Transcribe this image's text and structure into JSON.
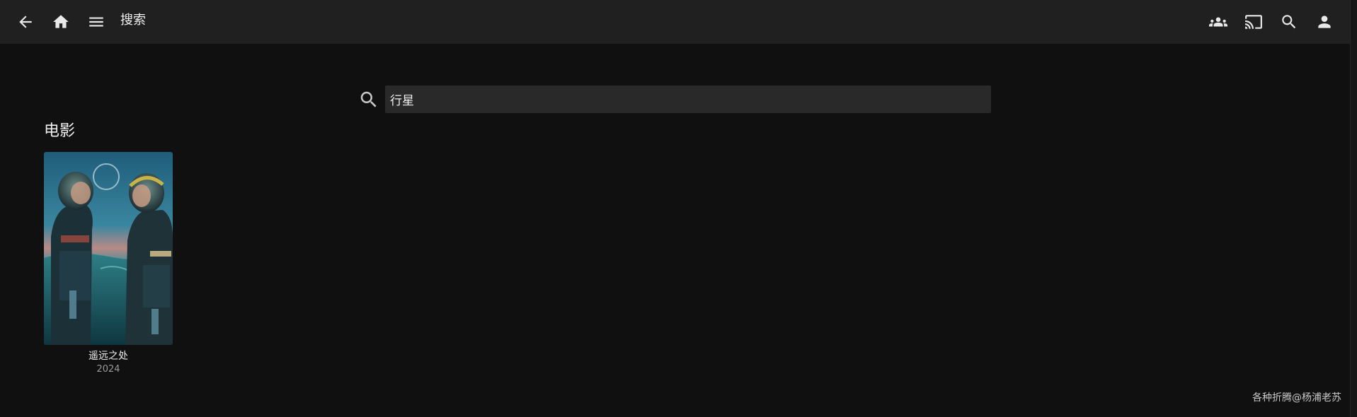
{
  "header": {
    "title": "搜索",
    "icons": {
      "back": "arrow-back-icon",
      "home": "home-icon",
      "menu": "menu-icon",
      "syncplay": "groups-icon",
      "cast": "cast-icon",
      "search": "search-icon",
      "user": "user-icon"
    }
  },
  "search": {
    "value": "行星",
    "placeholder": ""
  },
  "results": {
    "section_title": "电影",
    "items": [
      {
        "title": "遥远之处",
        "year": "2024"
      }
    ]
  },
  "watermark": "各种折腾@杨浦老苏",
  "colors": {
    "background": "#101010",
    "header": "#202020",
    "input": "#292929",
    "text": "#e6e6e6"
  }
}
